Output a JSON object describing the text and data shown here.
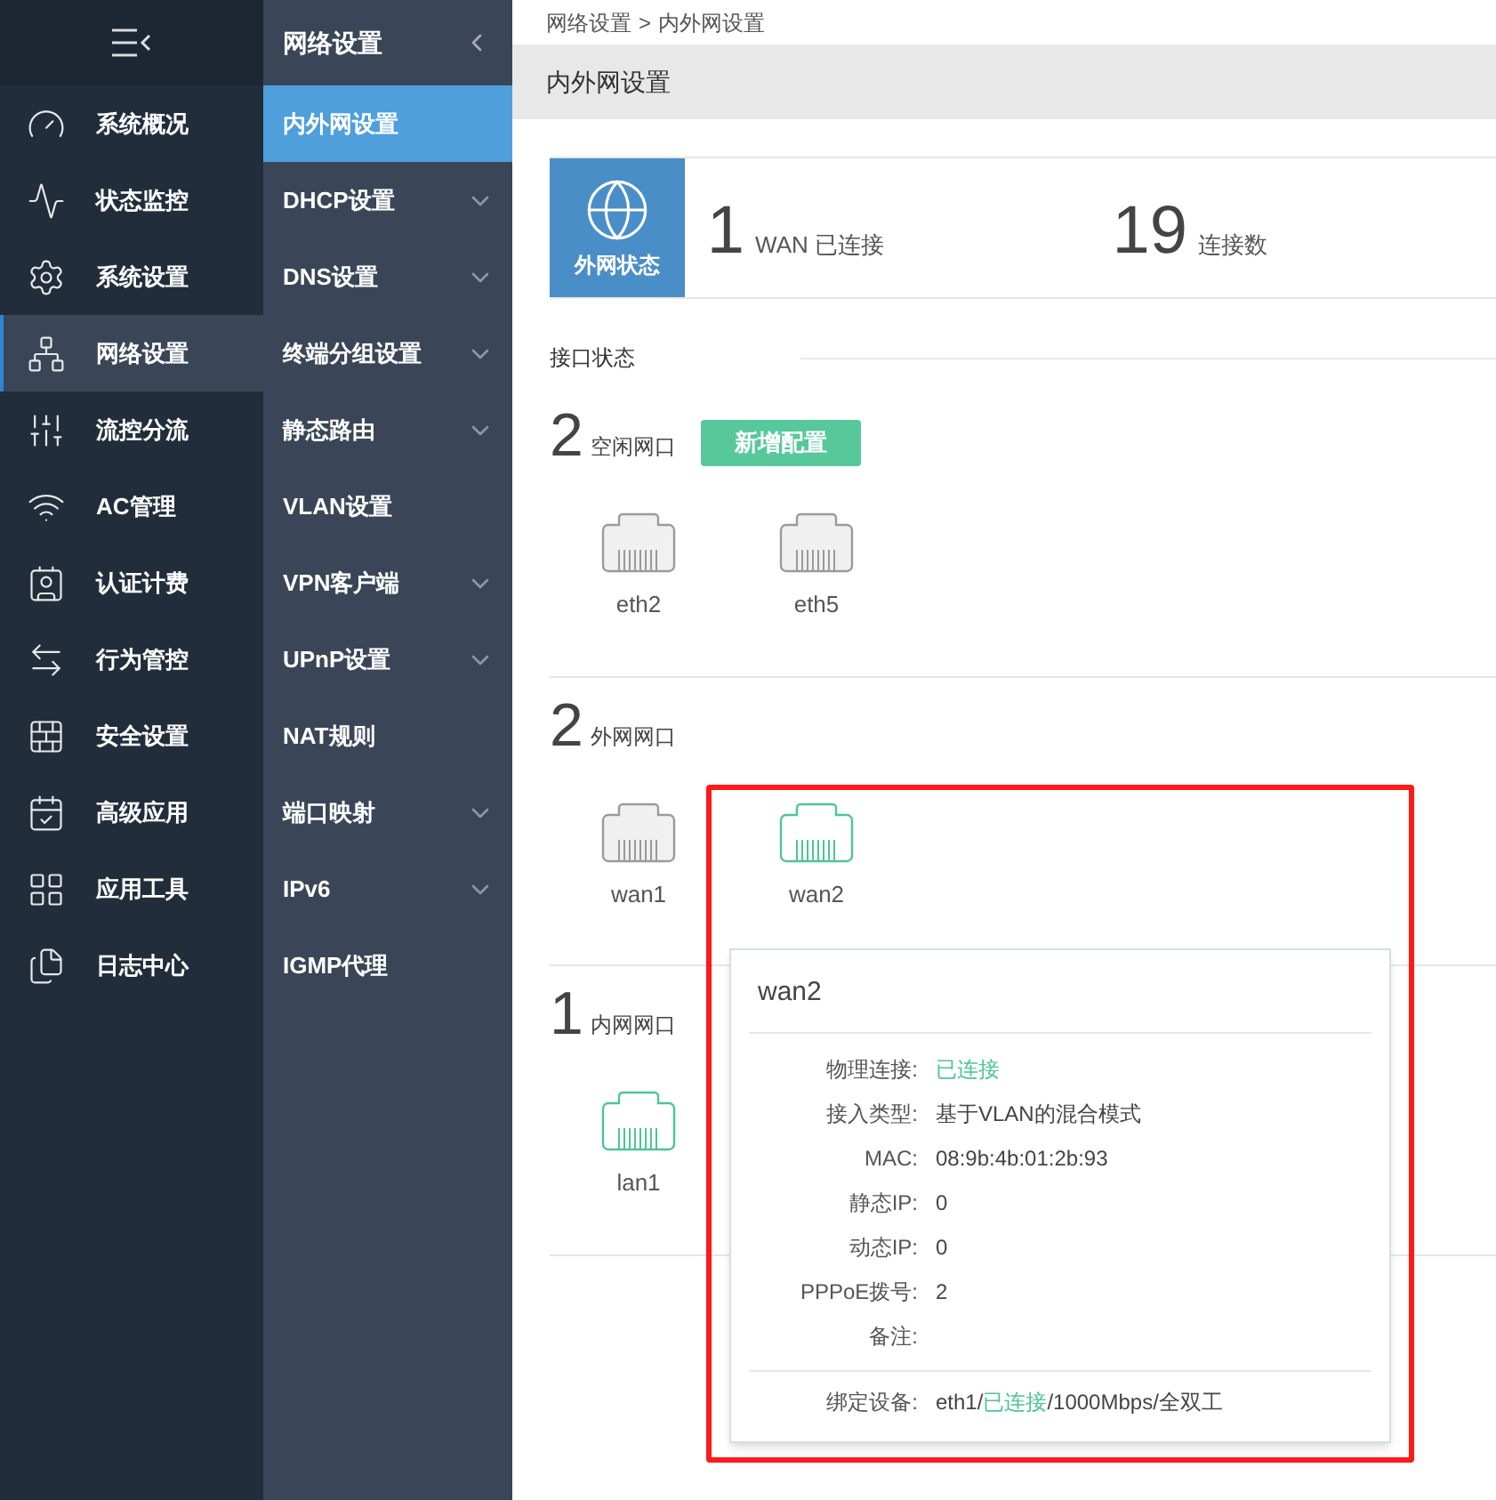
{
  "sidebar": {
    "items": [
      {
        "label": "系统概况",
        "selected": false
      },
      {
        "label": "状态监控",
        "selected": false
      },
      {
        "label": "系统设置",
        "selected": false
      },
      {
        "label": "网络设置",
        "selected": true
      },
      {
        "label": "流控分流",
        "selected": false
      },
      {
        "label": "AC管理",
        "selected": false
      },
      {
        "label": "认证计费",
        "selected": false
      },
      {
        "label": "行为管控",
        "selected": false
      },
      {
        "label": "安全设置",
        "selected": false
      },
      {
        "label": "高级应用",
        "selected": false
      },
      {
        "label": "应用工具",
        "selected": false
      },
      {
        "label": "日志中心",
        "selected": false
      }
    ]
  },
  "submenu": {
    "title": "网络设置",
    "items": [
      {
        "label": "内外网设置",
        "selected": true,
        "expandable": false
      },
      {
        "label": "DHCP设置",
        "selected": false,
        "expandable": true
      },
      {
        "label": "DNS设置",
        "selected": false,
        "expandable": true
      },
      {
        "label": "终端分组设置",
        "selected": false,
        "expandable": true
      },
      {
        "label": "静态路由",
        "selected": false,
        "expandable": true
      },
      {
        "label": "VLAN设置",
        "selected": false,
        "expandable": false
      },
      {
        "label": "VPN客户端",
        "selected": false,
        "expandable": true
      },
      {
        "label": "UPnP设置",
        "selected": false,
        "expandable": true
      },
      {
        "label": "NAT规则",
        "selected": false,
        "expandable": false
      },
      {
        "label": "端口映射",
        "selected": false,
        "expandable": true
      },
      {
        "label": "IPv6",
        "selected": false,
        "expandable": true
      },
      {
        "label": "IGMP代理",
        "selected": false,
        "expandable": false
      }
    ]
  },
  "breadcrumb": {
    "parent": "网络设置",
    "separator": ">",
    "current": "内外网设置"
  },
  "page_title": "内外网设置",
  "wan_status": {
    "label": "外网状态",
    "stats": [
      {
        "value": "1",
        "label": "WAN 已连接"
      },
      {
        "value": "19",
        "label": "连接数"
      }
    ]
  },
  "section_title": "接口状态",
  "groups": [
    {
      "count": "2",
      "label": "空闲网口",
      "button": "新增配置",
      "ports": [
        {
          "name": "eth2",
          "connected": false
        },
        {
          "name": "eth5",
          "connected": false
        }
      ]
    },
    {
      "count": "2",
      "label": "外网网口",
      "ports": [
        {
          "name": "wan1",
          "connected": false
        },
        {
          "name": "wan2",
          "connected": true
        }
      ]
    },
    {
      "count": "1",
      "label": "内网网口",
      "ports": [
        {
          "name": "lan1",
          "connected": true
        }
      ]
    }
  ],
  "popover": {
    "title": "wan2",
    "rows": [
      {
        "label": "物理连接:",
        "value": "已连接",
        "kind": "status"
      },
      {
        "label": "接入类型:",
        "value": "基于VLAN的混合模式",
        "kind": "text"
      },
      {
        "label": "MAC:",
        "value": "08:9b:4b:01:2b:93",
        "kind": "text"
      },
      {
        "label": "静态IP:",
        "value": "0",
        "kind": "text"
      },
      {
        "label": "动态IP:",
        "value": "0",
        "kind": "text"
      },
      {
        "label": "PPPoE拨号:",
        "value": "2",
        "kind": "text"
      },
      {
        "label": "备注:"
      }
    ],
    "bound": {
      "label": "绑定设备:",
      "value": "eth1/**已连接**/1000Mbps/全双工"
    }
  }
}
